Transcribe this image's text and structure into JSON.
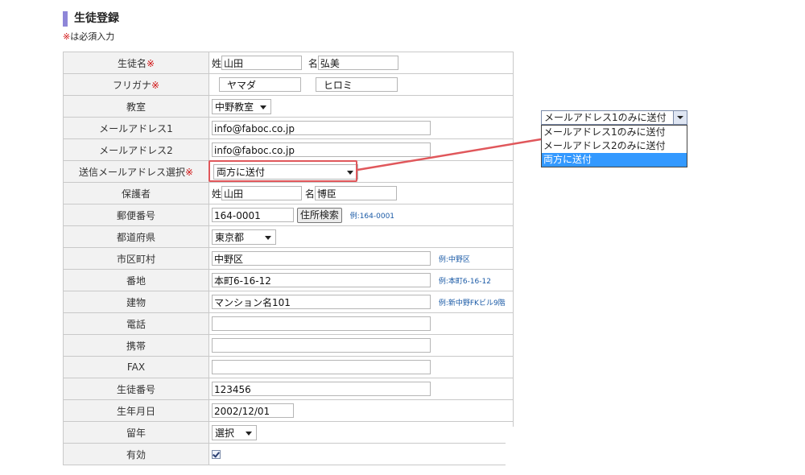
{
  "page": {
    "title": "生徒登録",
    "required_mark": "※",
    "required_note": "は必須入力"
  },
  "form": {
    "student_name": {
      "label": "生徒名",
      "required": "※",
      "sei_prefix": "姓",
      "sei_value": "山田",
      "mei_prefix": "名",
      "mei_value": "弘美"
    },
    "furigana": {
      "label": "フリガナ",
      "required": "※",
      "sei_value": "ヤマダ",
      "mei_value": "ヒロミ"
    },
    "classroom": {
      "label": "教室",
      "value": "中野教室"
    },
    "email1": {
      "label": "メールアドレス1",
      "value": "info@faboc.co.jp"
    },
    "email2": {
      "label": "メールアドレス2",
      "value": "info@faboc.co.jp"
    },
    "send_email": {
      "label": "送信メールアドレス選択",
      "required": "※",
      "value": "両方に送付"
    },
    "guardian": {
      "label": "保護者",
      "sei_prefix": "姓",
      "sei_value": "山田",
      "mei_prefix": "名",
      "mei_value": "博臣"
    },
    "postal": {
      "label": "郵便番号",
      "value": "164-0001",
      "button": "住所検索",
      "hint": "例:164-0001"
    },
    "prefecture": {
      "label": "都道府県",
      "value": "東京都"
    },
    "city": {
      "label": "市区町村",
      "value": "中野区",
      "hint": "例:中野区"
    },
    "address": {
      "label": "番地",
      "value": "本町6-16-12",
      "hint": "例:本町6-16-12"
    },
    "building": {
      "label": "建物",
      "value": "マンション名101",
      "hint": "例:新中野FKビル9階"
    },
    "phone": {
      "label": "電話",
      "value": ""
    },
    "mobile": {
      "label": "携帯",
      "value": ""
    },
    "fax": {
      "label": "FAX",
      "value": ""
    },
    "student_number": {
      "label": "生徒番号",
      "value": "123456"
    },
    "birthday": {
      "label": "生年月日",
      "value": "2002/12/01"
    },
    "repeat_year": {
      "label": "留年",
      "value": "選択"
    },
    "active": {
      "label": "有効",
      "checked": true
    }
  },
  "dropdown_popup": {
    "selected": "メールアドレス1のみに送付",
    "options": [
      {
        "label": "メールアドレス1のみに送付",
        "active": false
      },
      {
        "label": "メールアドレス2のみに送付",
        "active": false
      },
      {
        "label": "両方に送付",
        "active": true
      }
    ]
  },
  "colors": {
    "required": "#d01010",
    "highlight": "#e0575b",
    "option_active": "#3399ff",
    "title_bar": "#8e86d8",
    "hint": "#1a5aa6"
  }
}
